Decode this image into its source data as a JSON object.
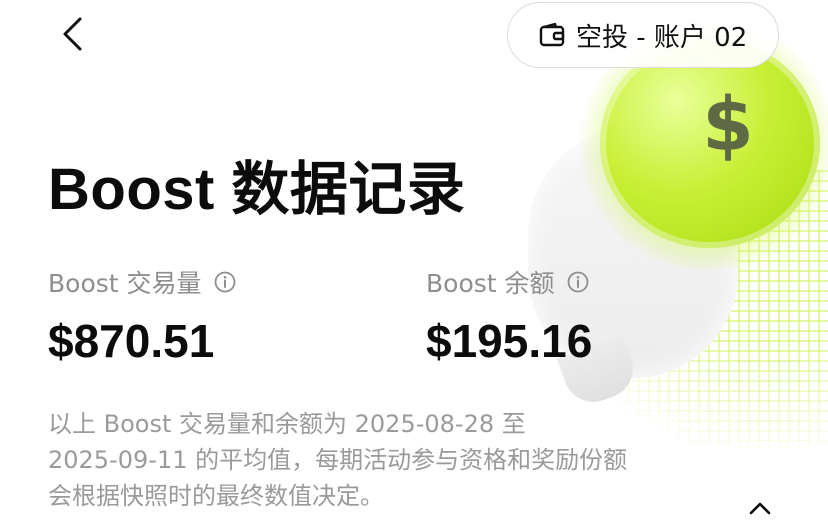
{
  "header": {
    "back_icon": "chevron-left-icon",
    "account_icon": "wallet-icon",
    "account_label": "空投 - 账户 02"
  },
  "page": {
    "title": "Boost 数据记录"
  },
  "stats": {
    "volume": {
      "label": "Boost 交易量",
      "value": "$870.51",
      "icon": "info-icon"
    },
    "balance": {
      "label": "Boost 余额",
      "value": "$195.16",
      "icon": "info-icon"
    }
  },
  "note": {
    "line1": "以上 Boost 交易量和余额为 2025-08-28 至",
    "line2": "2025-09-11 的平均值，每期活动参与资格和奖励份额",
    "line3": "会根据快照时的最终数值决定。"
  },
  "decoration": {
    "symbol": "$",
    "accent_color": "#c8ef34",
    "icon": "dollar-coin-illustration"
  },
  "footer": {
    "collapse_icon": "chevron-up-icon"
  }
}
